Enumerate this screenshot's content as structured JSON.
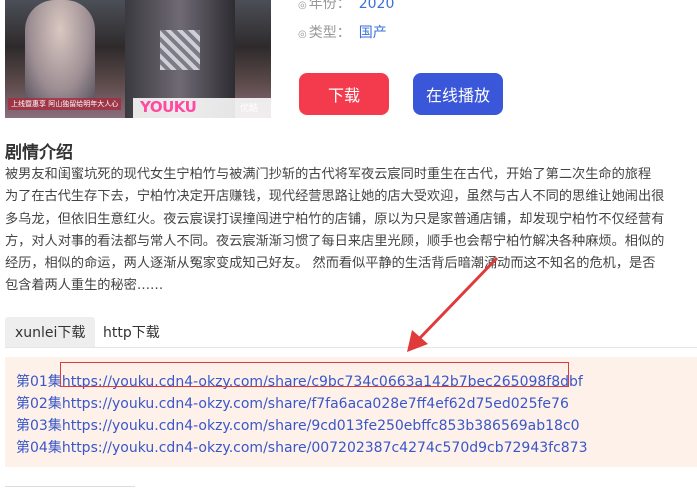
{
  "poster": {
    "caption": "上线暨惠享 阿山独留给明年大人心",
    "logo": "YOUKU",
    "logo2": "优酷"
  },
  "meta": {
    "year_label": "年份：",
    "year_value": "2020",
    "type_label": "类型：",
    "type_value": "国产"
  },
  "buttons": {
    "download": "下载",
    "play": "在线播放"
  },
  "synopsis": {
    "title": "剧情介绍",
    "lines": [
      "被男友和闺蜜坑死的现代女生宁柏竹与被满门抄斩的古代将军夜云宸同时重生在古代，开始了第二次生命的旅程",
      "为了在古代生存下去，宁柏竹决定开店赚钱，现代经营思路让她的店大受欢迎，虽然与古人不同的思维让她闹出很",
      "多乌龙，但依旧生意红火。夜云宸误打误撞闯进宁柏竹的店铺，原以为只是家普通店铺，却发现宁柏竹不仅经营有",
      "方，对人对事的看法都与常人不同。夜云宸渐渐习惯了每日来店里光顾，顺手也会帮宁柏竹解决各种麻烦。相似的",
      "经历，相似的命运，两人逐渐从冤家变成知己好友。 然而看似平静的生活背后暗潮涌动而这不知名的危机，是否",
      "包含着两人重生的秘密……"
    ]
  },
  "tabs": [
    "xunlei下载",
    "http下载"
  ],
  "episodes": [
    {
      "label": "第01集",
      "url": "https://youku.cdn4-okzy.com/share/c9bc734c0663a142b7bec265098f8dbf"
    },
    {
      "label": "第02集",
      "url": "https://youku.cdn4-okzy.com/share/f7fa6aca028e7ff4ef62d75ed025fe76"
    },
    {
      "label": "第03集",
      "url": "https://youku.cdn4-okzy.com/share/9cd013fe250ebffc853b386569ab18c0"
    },
    {
      "label": "第04集",
      "url": "https://youku.cdn4-okzy.com/share/007202387c4274c570d9cb72943fc873"
    }
  ],
  "colors": {
    "download_button": "#f43b4e",
    "play_button": "#3b57d9",
    "link": "#3a57c8",
    "annotation": "#e03a3a"
  }
}
